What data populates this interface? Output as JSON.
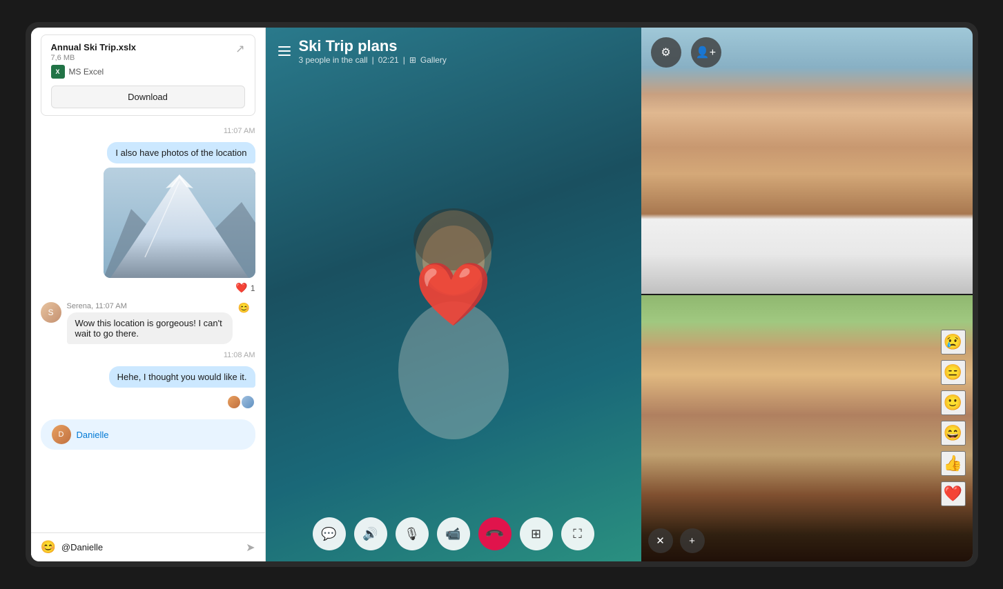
{
  "device": {
    "camera_visible": true
  },
  "chat": {
    "file": {
      "name": "Annual Ski Trip.xslx",
      "size": "7,6 MB",
      "type": "MS Excel",
      "download_label": "Download"
    },
    "messages": [
      {
        "id": "msg1",
        "timestamp": "11:07 AM",
        "type": "outgoing",
        "text": "I also have photos of the location"
      },
      {
        "id": "msg2",
        "type": "photo",
        "reaction": "❤️",
        "reaction_count": "1"
      },
      {
        "id": "msg3",
        "type": "incoming",
        "sender": "Serena",
        "sender_time": "Serena, 11:07 AM",
        "text": "Wow this location is gorgeous! I can't wait to go there."
      },
      {
        "id": "msg4",
        "timestamp": "11:08 AM",
        "type": "outgoing",
        "text": "Hehe, I thought you would like it."
      }
    ],
    "mention": {
      "user": "Danielle",
      "label": "Danielle"
    },
    "input": {
      "placeholder": "@Danielle",
      "value": "@Danielle"
    }
  },
  "call": {
    "title": "Ski Trip plans",
    "participants_text": "3 people in the call",
    "duration": "02:21",
    "view_mode": "Gallery",
    "controls": {
      "chat_label": "chat",
      "speaker_label": "speaker",
      "mic_label": "microphone",
      "video_label": "video",
      "end_label": "end call",
      "screen_share_label": "screen share",
      "fullscreen_label": "fullscreen"
    }
  },
  "grid": {
    "top_controls": {
      "settings_label": "settings",
      "add_person_label": "add person"
    },
    "emoji_reactions": [
      "😢",
      "😑",
      "🙂",
      "😄",
      "👍",
      "❤️"
    ],
    "bottom_controls": {
      "close_label": "close",
      "add_label": "add"
    }
  },
  "icons": {
    "hamburger": "☰",
    "chat": "💬",
    "speaker": "🔊",
    "mic": "🎙",
    "video_cam": "📹",
    "end_call": "📞",
    "screen_share": "⊞",
    "fullscreen": "⛶",
    "share": "↗",
    "emoji": "😊",
    "send": "➤",
    "settings": "⚙",
    "add_person": "👤",
    "close": "✕",
    "add": "+"
  }
}
